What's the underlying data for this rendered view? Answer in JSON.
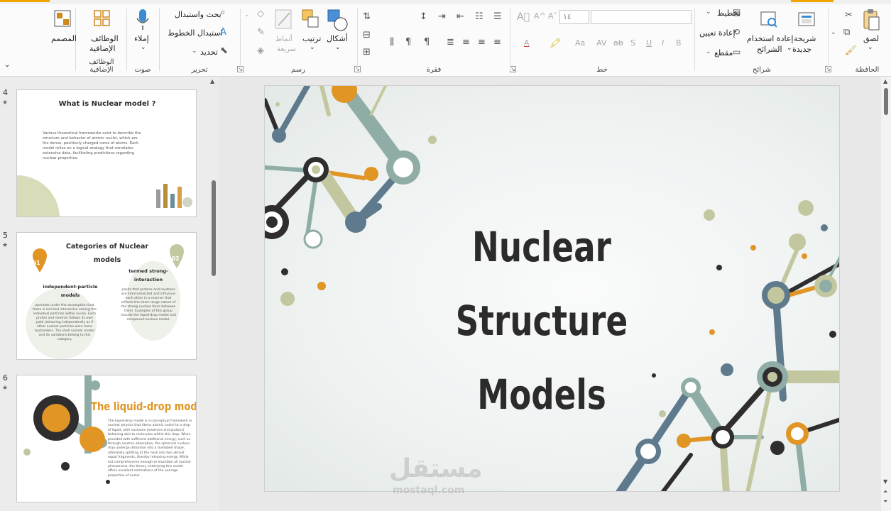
{
  "ribbon": {
    "groups": {
      "clipboard": {
        "label": "الحافظة",
        "paste": "لصق"
      },
      "slides": {
        "label": "شرائح",
        "new_slide_l1": "شريحة",
        "new_slide_l2": "جديدة",
        "reuse_l1": "إعادة استخدام",
        "reuse_l2": "الشرائح",
        "layout": "تخطيط",
        "reset": "إعادة تعيين",
        "section": "مقطع"
      },
      "font": {
        "label": "خط",
        "size": "١٤"
      },
      "paragraph": {
        "label": "فقرة"
      },
      "drawing": {
        "label": "رسم",
        "shapes": "أشكال",
        "arrange": "ترتيب",
        "quick_styles_l1": "أنماط",
        "quick_styles_l2": "سريعة"
      },
      "editing": {
        "label": "تحرير",
        "find": "بحث واستبدال",
        "replace_fonts": "استبدال الخطوط",
        "select": "تحديد"
      },
      "voice": {
        "label": "صوت",
        "dictate": "إملاء"
      },
      "addins": {
        "label": "الوظائف الإضافية",
        "addins_l1": "الوظائف",
        "addins_l2": "الإضافية"
      },
      "designer": {
        "label": "المصمم"
      }
    },
    "format_buttons": [
      "B",
      "I",
      "U",
      "S",
      "ab",
      "AV",
      "Aa"
    ]
  },
  "thumbnails": [
    {
      "number": "4",
      "title": "What is Nuclear model ?",
      "body": "Various theoretical frameworks exist to describe the structure and behavior of atomic nuclei, which are the dense, positively charged cores of atoms. Each model relies on a logical analogy that correlates extensive data, facilitating predictions regarding nuclear properties."
    },
    {
      "number": "5",
      "title_l1": "Categories of Nuclear",
      "title_l2": "models",
      "badge1": "01",
      "badge2": "02",
      "left_title_l1": "independent-particle",
      "left_title_l2": "models",
      "left_body": "operates under the assumption that there is minimal interaction among the individual particles within nuclei. Each proton and neutron follows its own path, behaving independently as if other nuclear particles were mere bystanders. The shell nuclear model and its variations belong to this category.",
      "right_title_l1": "termed strong-",
      "right_title_l2": "interaction",
      "right_body": "posits that protons and neutrons are interconnected and influence each other in a manner that reflects the short-range nature of the strong nuclear force between them. Examples of this group include the liquid-drop model and compound-nucleus model."
    },
    {
      "number": "6",
      "title": "The liquid-drop model",
      "body": "The liquid-drop model is a conceptual framework in nuclear physics that likens atomic nuclei to a drop of liquid, with nucleons (neutrons and protons) behaving akin to molecules within this drop. When provided with sufficient additional energy, such as through neutron absorption, the spherical nucleus may undergo distortion into a dumbbell shape, ultimately splitting at the neck into two almost equal fragments, thereby releasing energy. While not comprehensive enough to elucidate all nuclear phenomena, the theory underlying this model offers excellent estimations of the average properties of nuclei."
    }
  ],
  "slide": {
    "title_l1": "Nuclear Structure",
    "title_l2": "Models"
  },
  "watermark": {
    "text": "مستقل",
    "sub": "mostaql.com"
  },
  "colors": {
    "orange": "#e09525",
    "sage": "#8fada6",
    "slate": "#5e7a8c",
    "olive": "#c2c79f",
    "dark": "#2f2d2e"
  }
}
